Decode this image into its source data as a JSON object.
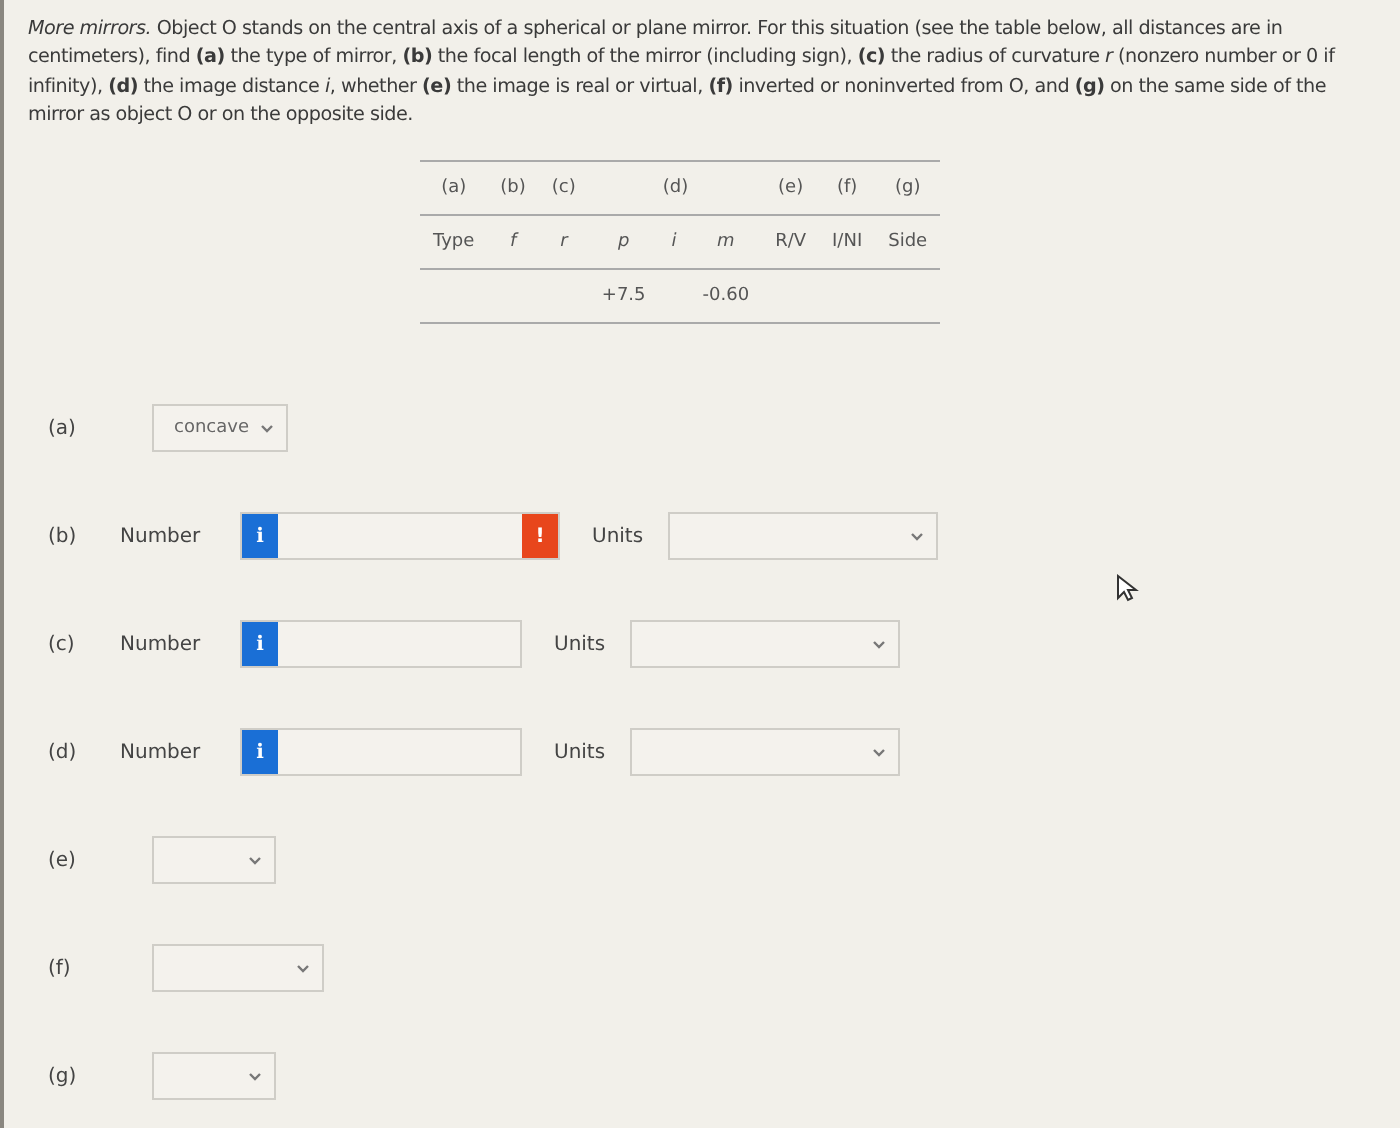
{
  "question": "*More mirrors.* Object O stands on the central axis of a spherical or plane mirror. For this situation (see the table below, all distances are in centimeters), find **(a)** the type of mirror, **(b)** the focal length of the mirror (including sign), **(c)** the radius of curvature *r* (nonzero number or 0 if infinity), **(d)** the image distance *i*, whether **(e)** the image is real or virtual, **(f)** inverted or noninverted from O, and **(g)** on the same side of the mirror as object O or on the opposite side.",
  "table": {
    "groups": [
      {
        "label": "(a)",
        "kind": "single"
      },
      {
        "label": "(b)",
        "kind": "single"
      },
      {
        "label": "(c)",
        "kind": "single"
      },
      {
        "label": "(d)",
        "kind": "triple"
      },
      {
        "label": "(e)",
        "kind": "single"
      },
      {
        "label": "(f)",
        "kind": "single"
      },
      {
        "label": "(g)",
        "kind": "single"
      }
    ],
    "columns": [
      {
        "label": "Type",
        "italic": false
      },
      {
        "label": "f",
        "italic": true
      },
      {
        "label": "r",
        "italic": true
      },
      {
        "label": "p",
        "italic": true,
        "value": "+7.5"
      },
      {
        "label": "i",
        "italic": true
      },
      {
        "label": "m",
        "italic": true,
        "value": "-0.60"
      },
      {
        "label": "R/V",
        "italic": false
      },
      {
        "label": "I/NI",
        "italic": false
      },
      {
        "label": "Side",
        "italic": false
      }
    ]
  },
  "answers": [
    {
      "kind": "select",
      "label": "(a)",
      "value": "concave"
    },
    {
      "kind": "number",
      "label": "(b)",
      "number_label": "Number",
      "info": "i",
      "error": true,
      "error_mark": "!",
      "units_label": "Units"
    },
    {
      "kind": "number",
      "label": "(c)",
      "number_label": "Number",
      "info": "i",
      "error": false,
      "units_label": "Units"
    },
    {
      "kind": "number",
      "label": "(d)",
      "number_label": "Number",
      "info": "i",
      "error": false,
      "units_label": "Units"
    },
    {
      "kind": "select",
      "label": "(e)"
    },
    {
      "kind": "select",
      "label": "(f)",
      "wide": true
    },
    {
      "kind": "select",
      "label": "(g)"
    }
  ]
}
